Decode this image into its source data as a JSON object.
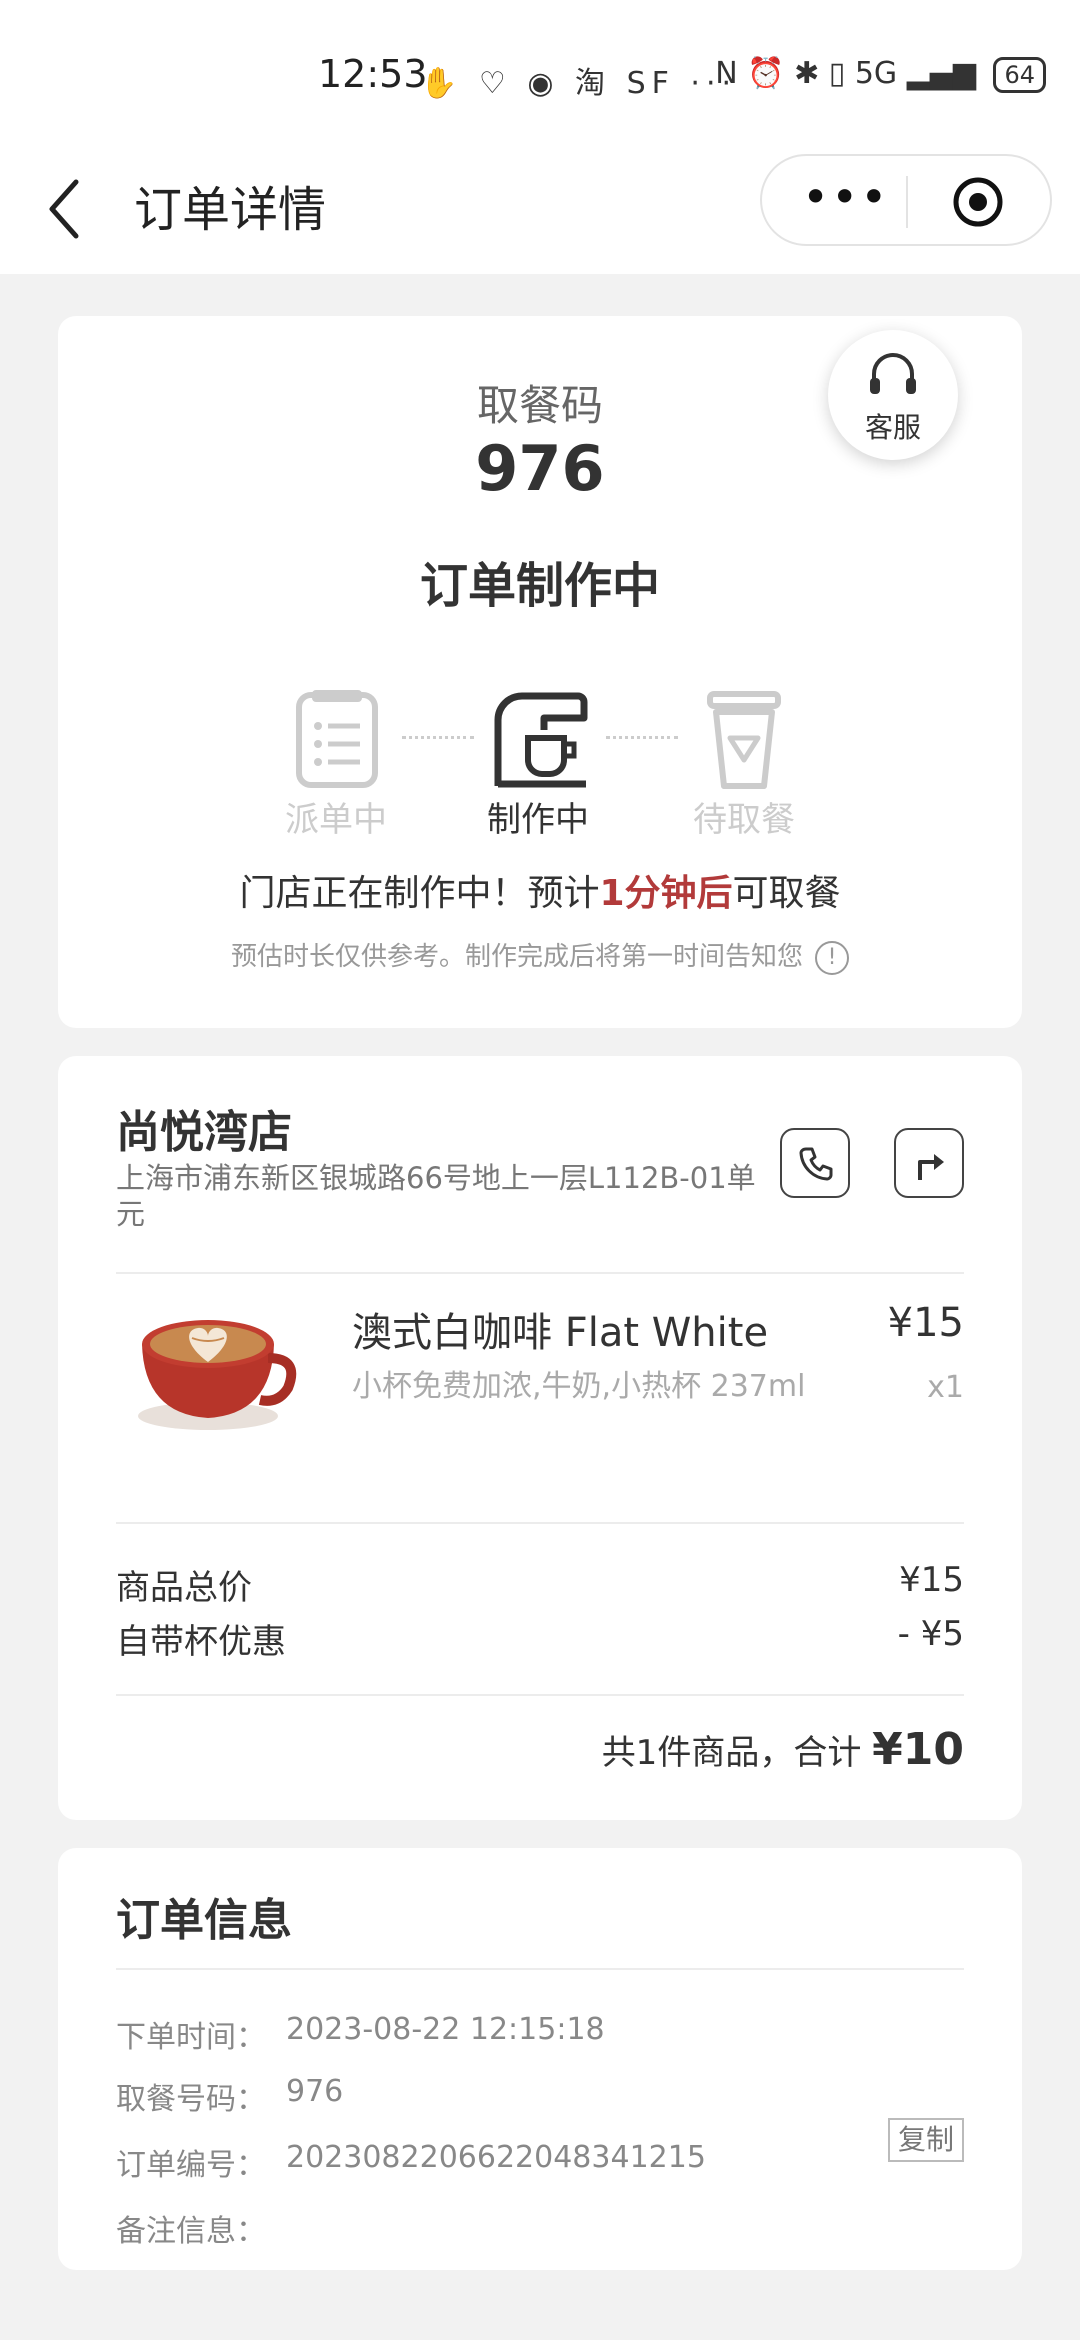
{
  "status_bar": {
    "time": "12:53",
    "left_icons": "✋ ♡ ◉ 淘 SF ···",
    "right_icons": "N ⏰ ✱ ▯ 5G ▂▄▆",
    "battery": "64"
  },
  "nav": {
    "title": "订单详情",
    "more_label": "•••"
  },
  "pickup": {
    "label": "取餐码",
    "code": "976",
    "status": "订单制作中",
    "customer_service": "客服"
  },
  "progress": {
    "steps": [
      {
        "label": "派单中",
        "active": false
      },
      {
        "label": "制作中",
        "active": true
      },
      {
        "label": "待取餐",
        "active": false
      }
    ],
    "eta_prefix": "门店正在制作中！预计",
    "eta_time": "1分钟后",
    "eta_suffix": "可取餐",
    "note": "预估时长仅供参考。制作完成后将第一时间告知您",
    "info_icon": "!"
  },
  "store": {
    "name": "尚悦湾店",
    "address": "上海市浦东新区银城路66号地上一层L112B-01单元"
  },
  "product": {
    "name": "澳式白咖啡 Flat White",
    "price": "¥15",
    "spec": "小杯免费加浓,牛奶,小热杯 237ml",
    "qty": "x1"
  },
  "summary": {
    "subtotal_label": "商品总价",
    "subtotal_value": "¥15",
    "discount_label": "自带杯优惠",
    "discount_value": "- ¥5",
    "total_prefix": "共1件商品，合计 ",
    "total_amount": "¥10"
  },
  "order_info": {
    "title": "订单信息",
    "rows": [
      {
        "label": "下单时间：",
        "value": "2023-08-22 12:15:18"
      },
      {
        "label": "取餐号码：",
        "value": "976"
      },
      {
        "label": "订单编号：",
        "value": "20230822066220483412​15"
      },
      {
        "label": "备注信息：",
        "value": ""
      }
    ],
    "copy_label": "复制"
  },
  "colors": {
    "accent_red": "#b23a3a",
    "inactive_gray": "#cccccc",
    "background": "#f2f2f2"
  }
}
